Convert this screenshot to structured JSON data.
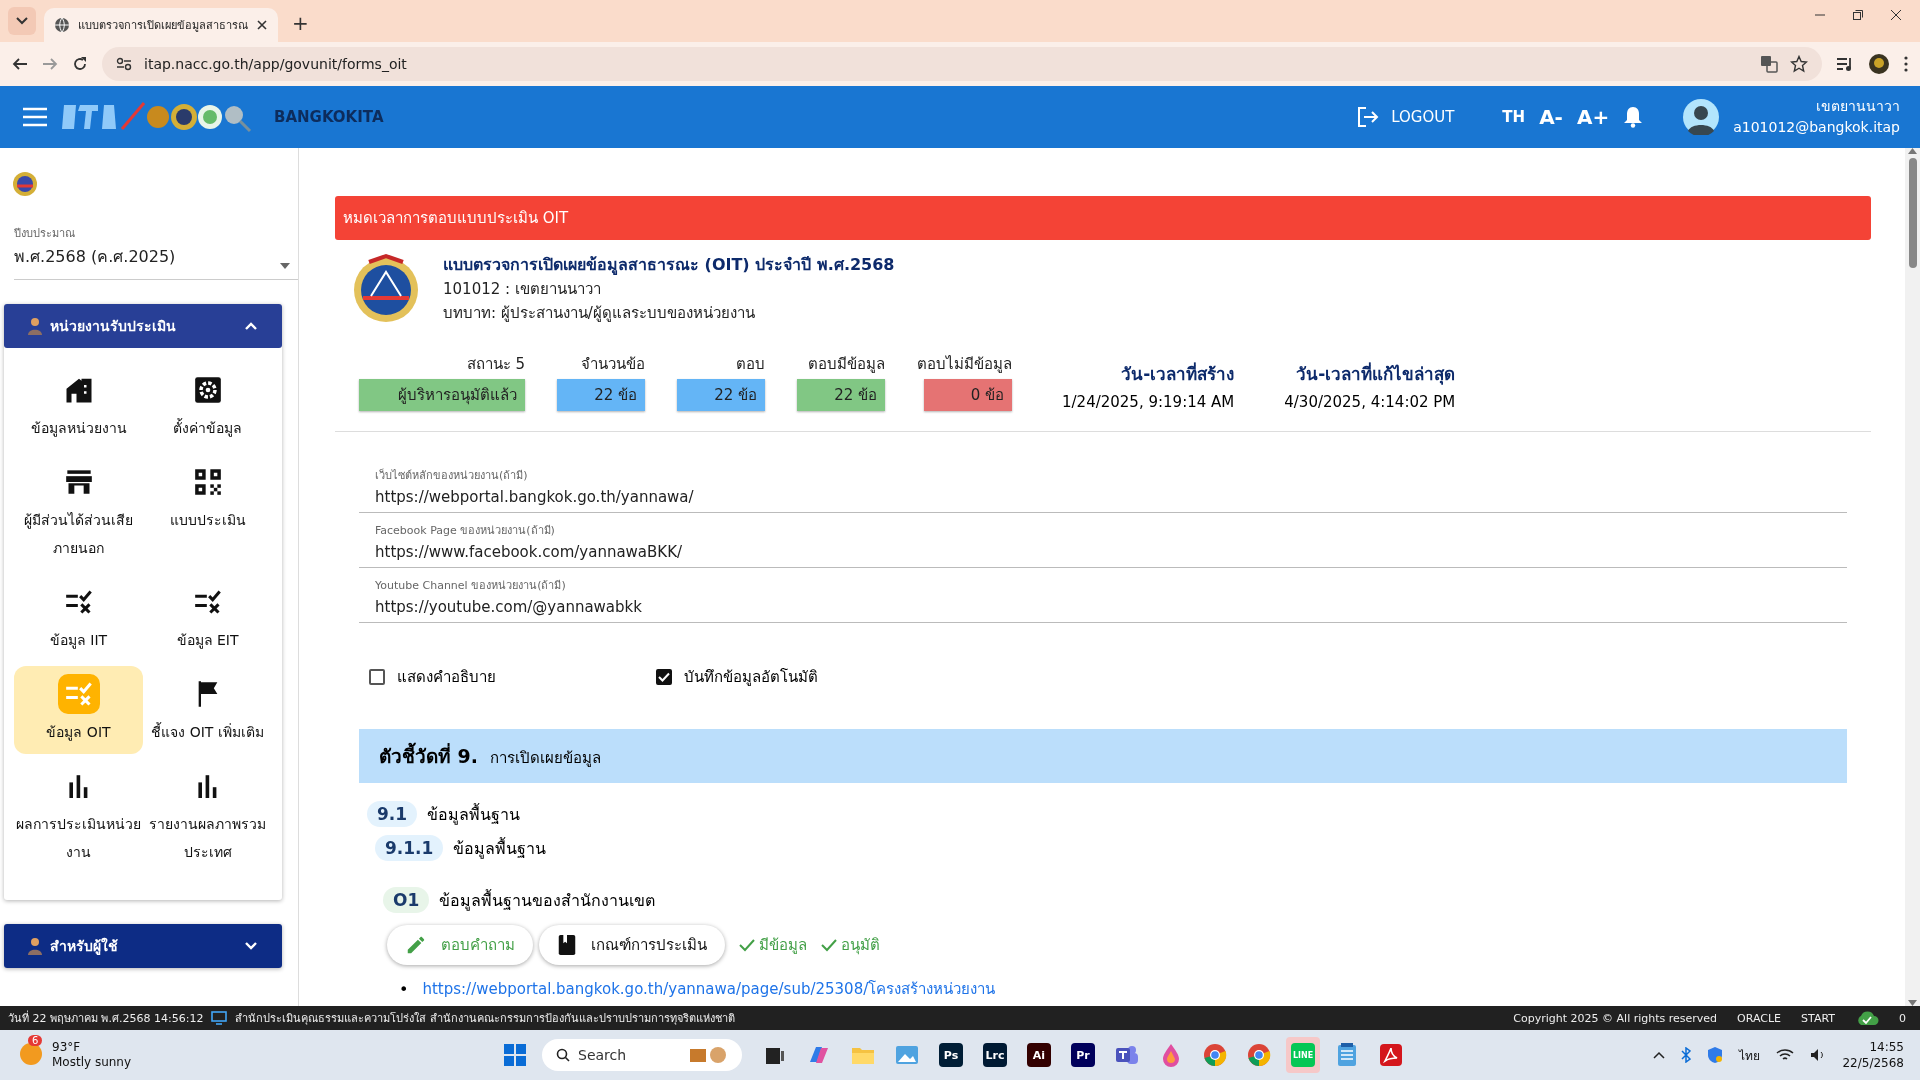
{
  "browser": {
    "tab_title": "แบบตรวจการเปิดเผยข้อมูลสาธารณ",
    "new_tab": "+",
    "url": "itap.nacc.go.th/app/govunit/forms_oit"
  },
  "header": {
    "site": "BANGKOKITA",
    "logout": "LOGOUT",
    "lang": {
      "label": "TH",
      "selected": true
    },
    "font_smaller": "A-",
    "font_larger": "A+",
    "user_name": "เขตยานนาวา",
    "user_email": "a101012@bangkok.itap"
  },
  "sidebar": {
    "fiscal_year": {
      "label": "ปีงบประมาณ",
      "value": "พ.ศ.2568 (ค.ศ.2025)"
    },
    "sections": [
      {
        "title": "หน่วยงานรับประเมิน",
        "expanded": true,
        "items": [
          {
            "label": "ข้อมูลหน่วยงาน",
            "kind": "house",
            "selected": false
          },
          {
            "label": "ตั้งค่าข้อมูล",
            "kind": "gear",
            "selected": false
          },
          {
            "label": "ผู้มีส่วนได้ส่วนเสียภายนอก",
            "kind": "store",
            "selected": false
          },
          {
            "label": "แบบประเมิน",
            "kind": "qr",
            "selected": false
          },
          {
            "label": "ข้อมูล IIT",
            "kind": "checklist",
            "selected": false
          },
          {
            "label": "ข้อมูล EIT",
            "kind": "checklist",
            "selected": false
          },
          {
            "label": "ข้อมูล OIT",
            "kind": "checklist",
            "selected": true
          },
          {
            "label": "ชี้แจง OIT เพิ่มเติม",
            "kind": "flag",
            "selected": false
          },
          {
            "label": "ผลการประเมินหน่วยงาน",
            "kind": "chart",
            "selected": false
          },
          {
            "label": "รายงานผลภาพรวมประเทศ",
            "kind": "chart",
            "selected": false
          }
        ]
      },
      {
        "title": "สำหรับผู้ใช้",
        "expanded": false
      }
    ]
  },
  "main": {
    "alert": "หมดเวลาการตอบแบบประเมิน OIT",
    "form": {
      "title": "แบบตรวจการเปิดเผยข้อมูลสาธารณะ (OIT) ประจำปี พ.ศ.2568",
      "unit": "101012 : เขตยานนาวา",
      "role": "บทบาท: ผู้ประสานงาน/ผู้ดูแลระบบของหน่วยงาน"
    },
    "stats": [
      {
        "label": "สถานะ 5",
        "value": "ผู้บริหารอนุมัติแล้ว",
        "color": "#81c784"
      },
      {
        "label": "จำนวนข้อ",
        "value": "22 ข้อ",
        "color": "#64b5f6"
      },
      {
        "label": "ตอบ",
        "value": "22 ข้อ",
        "color": "#64b5f6"
      },
      {
        "label": "ตอบมีข้อมูล",
        "value": "22 ข้อ",
        "color": "#81c784"
      },
      {
        "label": "ตอบไม่มีข้อมูล",
        "value": "0 ข้อ",
        "color": "#e57373"
      }
    ],
    "dates": [
      {
        "label": "วัน-เวลาที่สร้าง",
        "value": "1/24/2025, 9:19:14 AM"
      },
      {
        "label": "วัน-เวลาที่แก้ไขล่าสุด",
        "value": "4/30/2025, 4:14:02 PM"
      }
    ],
    "fields": [
      {
        "label": "เว็บไซต์หลักของหน่วยงาน(ถ้ามี)",
        "value": "https://webportal.bangkok.go.th/yannawa/"
      },
      {
        "label": "Facebook Page ของหน่วยงาน(ถ้ามี)",
        "value": "https://www.facebook.com/yannawaBKK/"
      },
      {
        "label": "Youtube Channel ของหน่วยงาน(ถ้ามี)",
        "value": "https://youtube.com/@yannawabkk"
      }
    ],
    "checkboxes": [
      {
        "label": "แสดงคำอธิบาย",
        "checked": false
      },
      {
        "label": "บันทึกข้อมูลอัตโนมัติ",
        "checked": true
      }
    ],
    "indicator": {
      "title": "ตัวชี้วัดที่ 9.",
      "subtitle": "การเปิดเผยข้อมูล"
    },
    "outline": [
      {
        "number": "9.1",
        "text": "ข้อมูลพื้นฐาน",
        "children": [
          {
            "number": "9.1.1",
            "text": "ข้อมูลพื้นฐาน",
            "children": [
              {
                "number": "O1",
                "text": "ข้อมูลพื้นฐานของสำนักงานเขต",
                "actions": [
                  {
                    "label": "ตอบคำถาม",
                    "kind": "pencil"
                  },
                  {
                    "label": "เกณฑ์การประเมิน",
                    "kind": "book"
                  }
                ],
                "statuses": [
                  "มีข้อมูล",
                  "อนุมัติ"
                ],
                "links": [
                  {
                    "marker": "•",
                    "url": "https://webportal.bangkok.go.th/yannawa/page/sub/25308/โครงสร้างหน่วยงาน"
                  }
                ]
              }
            ]
          }
        ]
      }
    ]
  },
  "status_bar": {
    "datetime": "วันที่ 22 พฤษภาคม พ.ศ.2568 14:56:12",
    "org": "สำนักประเมินคุณธรรมและความโปร่งใส สำนักงานคณะกรรมการป้องกันและปราบปรามการทุจริตแห่งชาติ",
    "copyright": "Copyright 2025 © All rights reserved",
    "items": [
      "ORACLE",
      "START"
    ],
    "count": "0"
  },
  "taskbar": {
    "weather": {
      "badge": "6",
      "temp": "93°F",
      "desc": "Mostly sunny"
    },
    "search": "Search",
    "apps": [
      {
        "kind": "windows",
        "selected": false
      },
      {
        "kind": "taskview",
        "selected": false
      },
      {
        "kind": "copilot",
        "selected": false
      },
      {
        "kind": "folder",
        "selected": false
      },
      {
        "kind": "photos",
        "selected": false
      },
      {
        "kind": "tile",
        "label": "Ps",
        "color": "#001e36",
        "selected": false
      },
      {
        "kind": "tile",
        "label": "Lrc",
        "color": "#001a33",
        "selected": false
      },
      {
        "kind": "tile",
        "label": "Ai",
        "color": "#330000",
        "selected": false
      },
      {
        "kind": "tile",
        "label": "Pr",
        "color": "#00005b",
        "selected": false
      },
      {
        "kind": "teams",
        "selected": false
      },
      {
        "kind": "paint",
        "selected": false
      },
      {
        "kind": "chrome",
        "selected": false
      },
      {
        "kind": "chrome",
        "selected": false
      },
      {
        "kind": "line",
        "label": "LINE",
        "selected": true
      },
      {
        "kind": "notepad",
        "selected": false
      },
      {
        "kind": "acrobat",
        "selected": false
      }
    ],
    "lang": "ไทย",
    "time": "14:55",
    "date": "22/5/2568"
  }
}
